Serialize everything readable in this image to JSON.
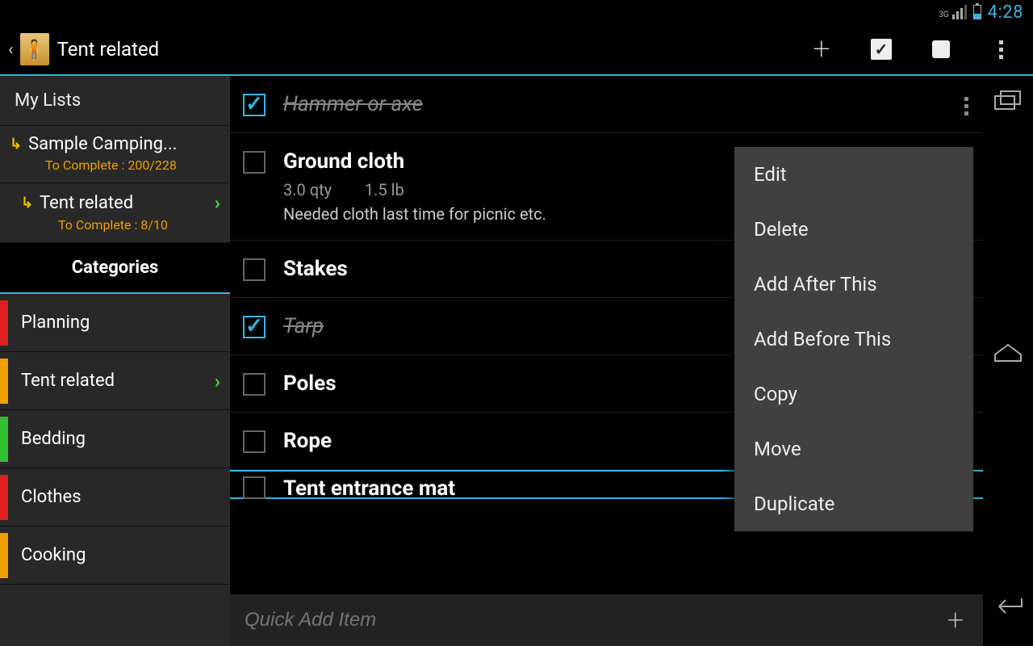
{
  "status": {
    "network": "3G",
    "time": "4:28"
  },
  "actionbar": {
    "title": "Tent related"
  },
  "sidebar": {
    "header": "My Lists",
    "lists": [
      {
        "name": "Sample Camping...",
        "sub": "To Complete : 200/228",
        "selected": false
      },
      {
        "name": "Tent related",
        "sub": "To Complete : 8/10",
        "selected": true
      }
    ],
    "categories_header": "Categories",
    "categories": [
      {
        "label": "Planning",
        "color": "#e02020",
        "selected": false
      },
      {
        "label": "Tent related",
        "color": "#f0a000",
        "selected": true
      },
      {
        "label": "Bedding",
        "color": "#30c030",
        "selected": false
      },
      {
        "label": "Clothes",
        "color": "#e02020",
        "selected": false
      },
      {
        "label": "Cooking",
        "color": "#f0a000",
        "selected": false
      }
    ]
  },
  "items": [
    {
      "name": "Hammer or axe",
      "done": true
    },
    {
      "name": "Ground cloth",
      "done": false,
      "meta": "3.0 qty    1.5 lb",
      "note": "Needed cloth last time for picnic etc."
    },
    {
      "name": "Stakes",
      "done": false
    },
    {
      "name": "Tarp",
      "done": true
    },
    {
      "name": "Poles",
      "done": false
    },
    {
      "name": "Rope",
      "done": false
    }
  ],
  "cutoff_item": "Tent entrance mat",
  "context_menu": [
    "Edit",
    "Delete",
    "Add After This",
    "Add Before This",
    "Copy",
    "Move",
    "Duplicate"
  ],
  "quick_add": {
    "placeholder": "Quick Add Item"
  }
}
